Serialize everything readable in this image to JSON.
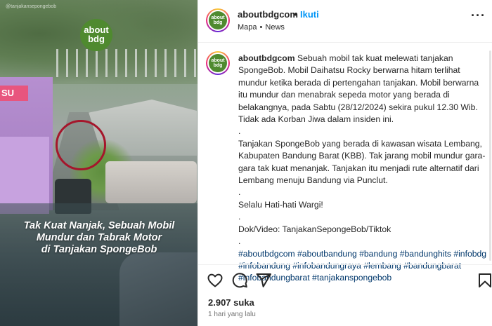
{
  "media": {
    "logo_line1": "about",
    "logo_line2": "bdg",
    "sign_text": "SU",
    "watermark": "@tanjakansepongebob",
    "caption_line1": "Tak Kuat Nanjak, Sebuah Mobil",
    "caption_line2": "Mundur dan Tabrak Motor",
    "caption_line3": "di Tanjakan SpongeBob",
    "circle_color": "#a5162b"
  },
  "header": {
    "username": "aboutbdgcom",
    "dot": "•",
    "follow_label": "Ikuti",
    "location": "Mapa",
    "sep": "•",
    "category": "News",
    "more_icon": "more-icon"
  },
  "post": {
    "username": "aboutbdgcom",
    "caption_lines": [
      "Sebuah mobil tak kuat melewati tanjakan SpongeBob. Mobil Daihatsu Rocky berwarna hitam terlihat mundur ketika berada di pertengahan tanjakan. Mobil berwarna itu mundur dan menabrak sepeda motor yang berada di belakangnya, pada Sabtu (28/12/2024) sekira pukul 12.30 Wib. Tidak ada Korban Jiwa dalam insiden ini.",
      ".",
      "Tanjakan SpongeBob yang berada di kawasan wisata Lembang, Kabupaten Bandung Barat (KBB). Tak jarang mobil mundur gara-gara tak kuat menanjak. Tanjakan itu menjadi rute alternatif dari Lembang menuju Bandung via Punclut.",
      ".",
      "Selalu Hati-hati Wargi!",
      ".",
      "Dok/Video: TanjakanSepongeBob/Tiktok",
      "."
    ],
    "hashtags": "#aboutbdgcom #aboutbandung #bandung #bandunghits #infobdg #infobandung #infobandungraya #lembang #bandungbarat #infobandungbarat #tanjakanspongebob",
    "likes": "2.907 suka",
    "time": "1 hari yang lalu"
  },
  "colors": {
    "follow": "#0095f6",
    "hashtag": "#00376b",
    "brand_green": "#4f8a2f"
  }
}
